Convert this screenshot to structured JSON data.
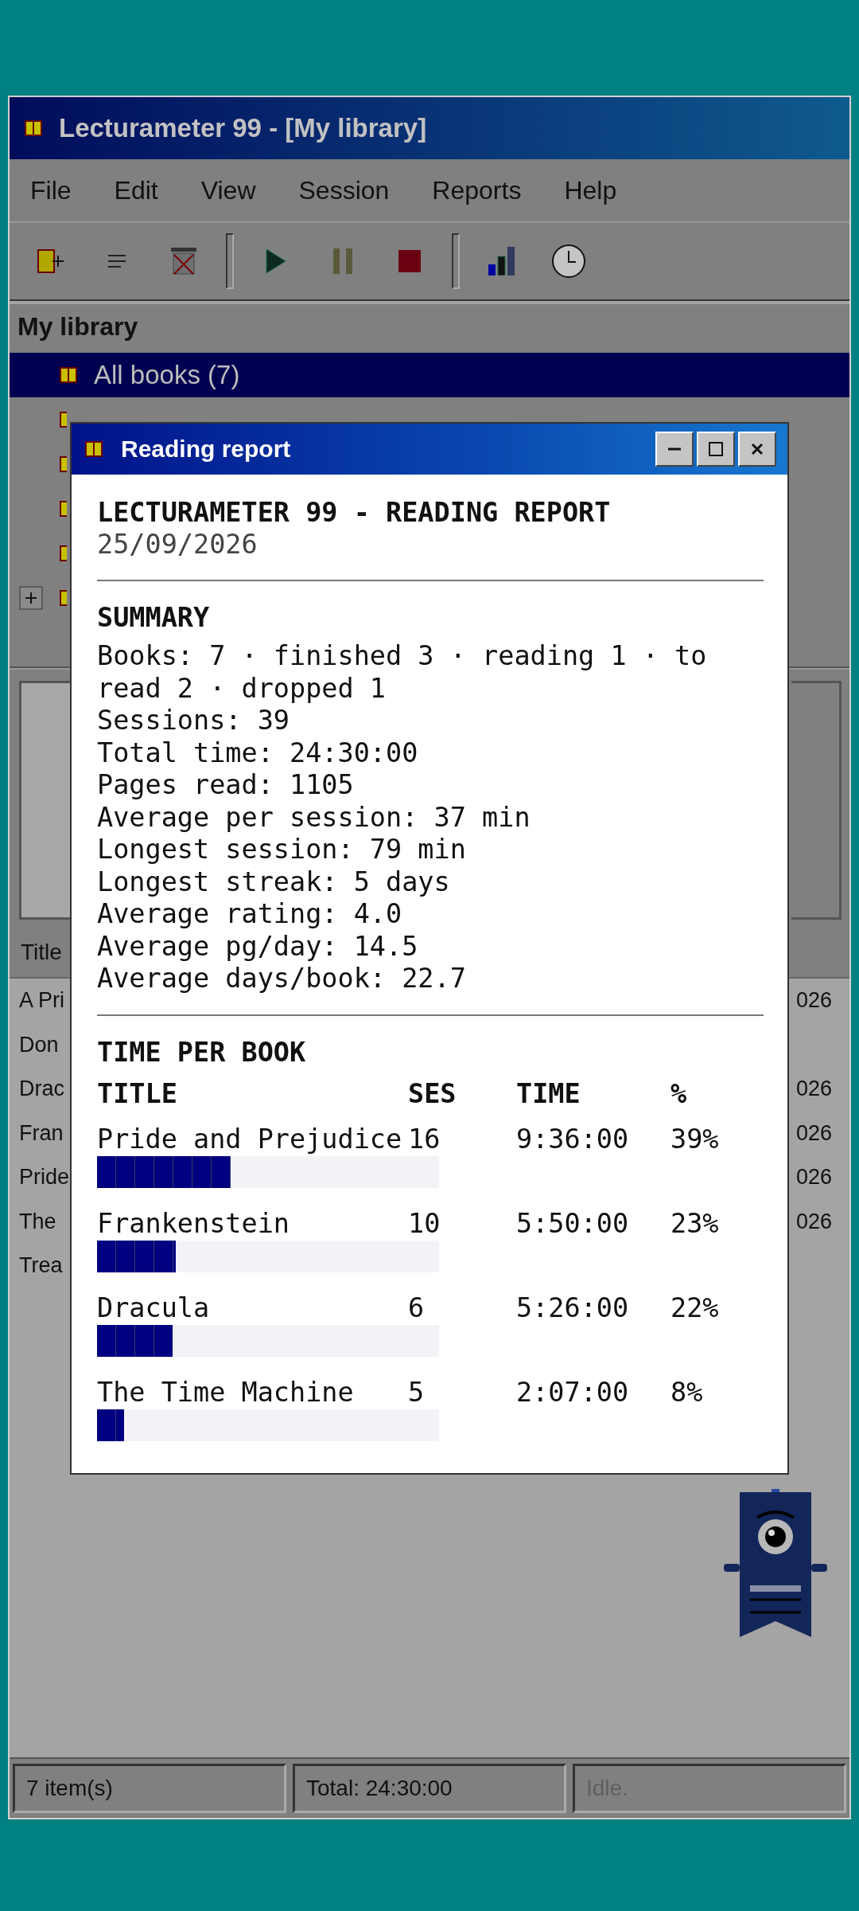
{
  "window": {
    "title": "Lecturameter 99 - [My library]"
  },
  "menu": [
    "File",
    "Edit",
    "View",
    "Session",
    "Reports",
    "Help"
  ],
  "toolbar": [
    {
      "kind": "new-book"
    },
    {
      "kind": "list"
    },
    {
      "kind": "delete"
    },
    {
      "kind": "separator"
    },
    {
      "kind": "play"
    },
    {
      "kind": "pause"
    },
    {
      "kind": "stop"
    },
    {
      "kind": "separator"
    },
    {
      "kind": "chart"
    },
    {
      "kind": "clock"
    }
  ],
  "tree": {
    "title": "My library",
    "items": [
      {
        "label": "All books (7)",
        "selected": true
      },
      {
        "selected": false
      },
      {
        "selected": false
      },
      {
        "selected": false
      },
      {
        "selected": false
      },
      {
        "selected": false,
        "expanded": false
      }
    ]
  },
  "list": {
    "columns": [
      "Title"
    ],
    "rows": [
      {
        "column_1": "A Pri",
        "column_2": "026"
      },
      {
        "column_1": "Don"
      },
      {
        "column_1": "Drac",
        "column_2": "026"
      },
      {
        "column_1": "Fran",
        "column_2": "026"
      },
      {
        "column_1": "Pride",
        "column_2": "026"
      },
      {
        "column_1": "The",
        "column_2": "026"
      },
      {
        "column_1": "Trea"
      }
    ]
  },
  "dialog": {
    "title": "Reading report",
    "heading": "LECTURAMETER 99 - READING REPORT",
    "date": "25/09/2026",
    "summary": {
      "title": "SUMMARY",
      "lines": [
        "Books: 7 · finished 3 · reading 1 · to read 2 · dropped 1",
        "Sessions: 39",
        "Total time: 24:30:00",
        "Pages read: 1105",
        "Average per session: 37 min",
        "Longest session: 79 min",
        "Longest streak: 5 days",
        "Average rating: 4.0",
        "Average pg/day: 14.5",
        "Average days/book: 22.7"
      ]
    },
    "time_per_book": {
      "title": "TIME PER BOOK",
      "columns": [
        "TITLE",
        "SES",
        "TIME",
        "%"
      ],
      "rows": [
        {
          "title": "Pride and Prejudice",
          "sessions": "16",
          "time": "9:36:00",
          "percent": "39%",
          "level": 0.39
        },
        {
          "title": "Frankenstein",
          "sessions": "10",
          "time": "5:50:00",
          "percent": "23%",
          "level": 0.23
        },
        {
          "title": "Dracula",
          "sessions": "6",
          "time": "5:26:00",
          "percent": "22%",
          "level": 0.22
        },
        {
          "title": "The Time Machine",
          "sessions": "5",
          "time": "2:07:00",
          "percent": "8%",
          "level": 0.08
        }
      ]
    }
  },
  "status_bar": [
    {
      "text": "7 item(s)",
      "dimmed": false
    },
    {
      "text": "Total: 24:30:00",
      "dimmed": false
    },
    {
      "text": "Idle.",
      "dimmed": true
    }
  ]
}
